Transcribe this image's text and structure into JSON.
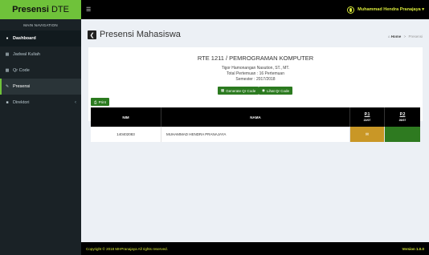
{
  "brand": {
    "bold": "Presensi",
    "rest": "DTE"
  },
  "sidebar": {
    "header": "MAIN NAVIGATION",
    "items": [
      {
        "label": "Dashboard",
        "icon": "dashboard-icon"
      },
      {
        "label": "Jadwal Kuliah",
        "icon": "calendar-icon"
      },
      {
        "label": "Qr Code",
        "icon": "qrcode-icon"
      },
      {
        "label": "Presensi",
        "icon": "edit-icon"
      },
      {
        "label": "Direktori",
        "icon": "book-icon"
      }
    ]
  },
  "topbar": {
    "user": "Muhammad Hendra Pranajaya ▾"
  },
  "header": {
    "title": "Presensi Mahasiswa",
    "breadcrumb_home": "Home",
    "breadcrumb_current": "Presensi"
  },
  "course": {
    "title": "RTE 1211 / PEMROGRAMAN KOMPUTER",
    "lecturer": "Tigor Hamonangan Nasution, ST., MT.",
    "total": "Total Pertemuan : 16 Pertemuan",
    "semester": "Semester : 2017/2018"
  },
  "buttons": {
    "generate": "Generate Qr Code",
    "view": "Lihat Qr Code",
    "print": "Print"
  },
  "table": {
    "headers": {
      "nim": "NIM",
      "nama": "NAMA"
    },
    "sessions": [
      {
        "label": "P.1",
        "date": "22/07"
      },
      {
        "label": "P.2",
        "date": "26/07"
      }
    ],
    "rows": [
      {
        "nim": "140402083",
        "nama": "MUHAMMAD HENDRA PRANAJAYA",
        "p1": "✉",
        "p2": ""
      }
    ]
  },
  "footer": {
    "copyright": "Copyright © 2018 MHPranajaya All rights reserved.",
    "version": "Version 1.0.0"
  },
  "colors": {
    "brand": "#6fc23a",
    "accent": "#d8e83a",
    "button": "#2b7a1f",
    "p1_cell": "#c99726",
    "p2_cell": "#2e7a20"
  }
}
